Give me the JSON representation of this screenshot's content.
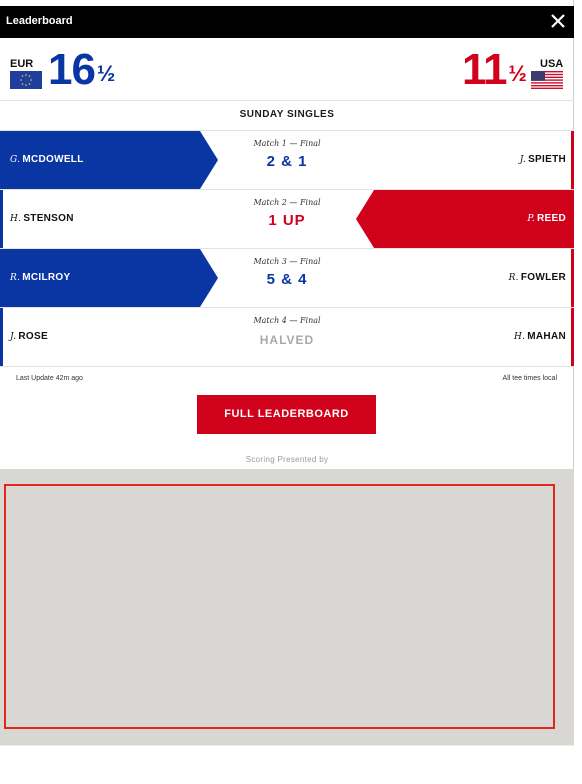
{
  "window": {
    "title": "Leaderboard",
    "close_icon": "close-icon"
  },
  "score": {
    "eur": {
      "code": "EUR",
      "whole": "16",
      "fraction": "½",
      "color": "#0a36a3"
    },
    "usa": {
      "code": "USA",
      "whole": "11",
      "fraction": "½",
      "color": "#d0021b"
    }
  },
  "section_title": "SUNDAY SINGLES",
  "matches": [
    {
      "label": "Match 1 — Final",
      "result": "2 & 1",
      "left": {
        "initial": "G.",
        "name": "MCDOWELL"
      },
      "right": {
        "initial": "J.",
        "name": "SPIETH"
      },
      "winner": "EUR"
    },
    {
      "label": "Match 2 — Final",
      "result": "1 UP",
      "left": {
        "initial": "H.",
        "name": "STENSON"
      },
      "right": {
        "initial": "P.",
        "name": "REED"
      },
      "winner": "USA"
    },
    {
      "label": "Match 3 — Final",
      "result": "5 & 4",
      "left": {
        "initial": "R.",
        "name": "MCILROY"
      },
      "right": {
        "initial": "R.",
        "name": "FOWLER"
      },
      "winner": "EUR"
    },
    {
      "label": "Match 4 — Final",
      "result": "HALVED",
      "left": {
        "initial": "J.",
        "name": "ROSE"
      },
      "right": {
        "initial": "H.",
        "name": "MAHAN"
      },
      "winner": "HALVED"
    }
  ],
  "footer": {
    "last_update": "Last Update 42m ago",
    "tee_times": "All tee times local",
    "button_label": "FULL LEADERBOARD",
    "presented_by": "Scoring Presented by"
  }
}
